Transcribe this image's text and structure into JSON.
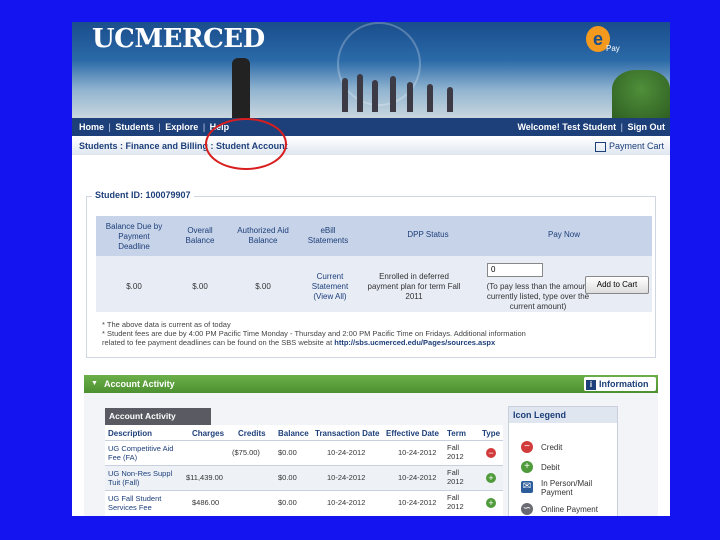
{
  "header": {
    "logo_text": "UCMERCED",
    "badge_letter": "e",
    "badge_sub": "Pay"
  },
  "nav": {
    "items": [
      "Home",
      "Students",
      "Explore",
      "Help"
    ],
    "welcome": "Welcome! Test Student",
    "sign_out": "Sign Out"
  },
  "breadcrumb": {
    "path": "Students : Finance and Billing : Student Account",
    "payment_cart": "Payment Cart"
  },
  "student": {
    "id_label": "Student ID: 100079907",
    "columns": [
      "Balance Due by Payment Deadline",
      "Overall Balance",
      "Authorized Aid Balance",
      "eBill Statements",
      "DPP Status",
      "Pay Now"
    ],
    "balance_due": "$.00",
    "overall_balance": "$.00",
    "aid_balance": "$.00",
    "statements_link": "Current Statement (View All)",
    "dpp_status": "Enrolled in deferred payment plan for term Fall 2011",
    "pay_amount": "0",
    "pay_hint": "(To pay less than the amount currently listed, type over the current amount)",
    "add_to_cart": "Add to Cart",
    "note1": "* The above data is current as of today",
    "note2": "* Student fees are due by 4:00 PM Pacific Time Monday - Thursday and 2:00 PM Pacific Time on Fridays. Additional information",
    "note3_prefix": "related to fee payment deadlines can be found on the SBS website at ",
    "note3_link": "http://sbs.ucmerced.edu/Pages/sources.aspx"
  },
  "activity": {
    "bar_title": "Account Activity",
    "information": "Information",
    "tab_label": "Account Activity",
    "headers": [
      "Description",
      "Charges",
      "Credits",
      "Balance",
      "Transaction Date",
      "Effective Date",
      "Term",
      "Type"
    ],
    "rows": [
      {
        "description": "UG Competitive Aid Fee (FA)",
        "charges": "",
        "credits": "($75.00)",
        "balance": "$0.00",
        "transaction_date": "10-24-2012",
        "effective_date": "10-24-2012",
        "term": "Fall 2012",
        "type": "credit"
      },
      {
        "description": "UG Non-Res Suppl Tuit (Fall)",
        "charges": "$11,439.00",
        "credits": "",
        "balance": "$0.00",
        "transaction_date": "10-24-2012",
        "effective_date": "10-24-2012",
        "term": "Fall 2012",
        "type": "debit"
      },
      {
        "description": "UG Fall Student Services Fee",
        "charges": "$486.00",
        "credits": "",
        "balance": "$0.00",
        "transaction_date": "10-24-2012",
        "effective_date": "10-24-2012",
        "term": "Fall 2012",
        "type": "debit"
      }
    ],
    "legend_title": "Icon Legend",
    "legend": [
      {
        "label": "Credit",
        "icon": "minus-circle-icon"
      },
      {
        "label": "Debit",
        "icon": "plus-circle-icon"
      },
      {
        "label": "In Person/Mail Payment",
        "icon": "envelope-icon"
      },
      {
        "label": "Online Payment",
        "icon": "mouse-icon"
      }
    ]
  },
  "colors": {
    "background": "#1414f0",
    "nav": "#1d3f7a",
    "activity_bar": "#5a9f3c",
    "annotation_circle": "#d81e1e"
  }
}
